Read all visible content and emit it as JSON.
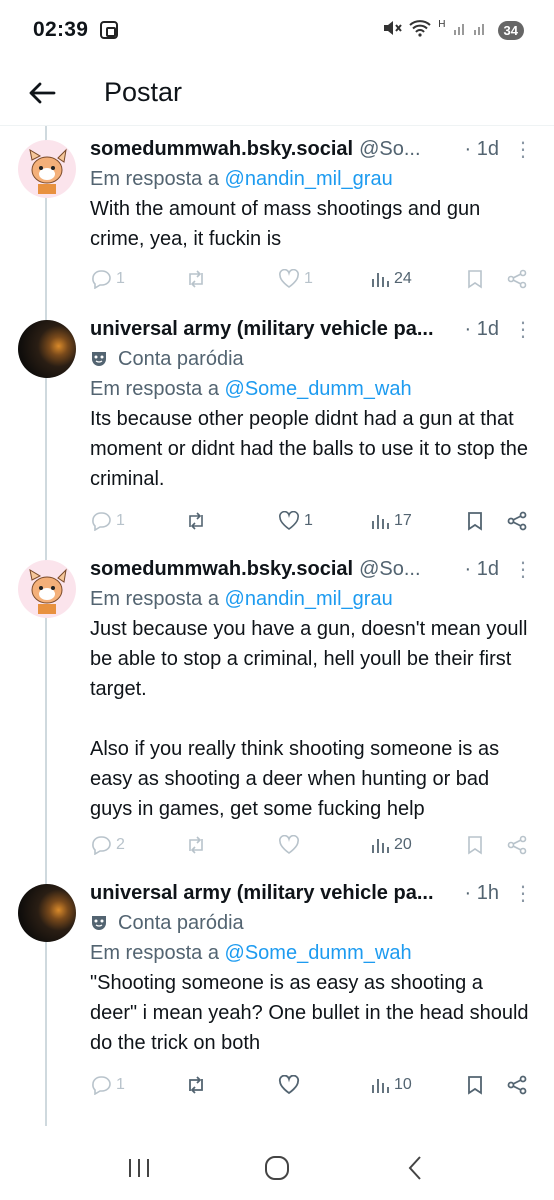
{
  "status_bar": {
    "time": "02:39",
    "battery": "34",
    "signal_label": "H"
  },
  "header": {
    "title": "Postar"
  },
  "replies": [
    {
      "display_name": "somedummwah.bsky.social",
      "handle": "@So...",
      "time": "· 1d",
      "parody": "",
      "reply_prefix": "Em resposta a ",
      "reply_to": "@nandin_mil_grau",
      "text": "With the amount of mass shootings and gun crime, yea, it fuckin is",
      "reply_count": "1",
      "repost_count": "",
      "like_count": "1",
      "view_count": "24"
    },
    {
      "display_name": "universal army (military vehicle pa...",
      "handle": "",
      "time": "· 1d",
      "parody": "Conta paródia",
      "reply_prefix": "Em resposta a ",
      "reply_to": "@Some_dumm_wah",
      "text": "Its because other people didnt had a gun at that moment or didnt had the balls to use it to stop the criminal.",
      "reply_count": "1",
      "repost_count": "",
      "like_count": "1",
      "view_count": "17"
    },
    {
      "display_name": "somedummwah.bsky.social",
      "handle": "@So...",
      "time": "· 1d",
      "parody": "",
      "reply_prefix": "Em resposta a ",
      "reply_to": "@nandin_mil_grau",
      "text": "Just because you have a gun, doesn't mean youll be able to stop a criminal, hell youll be their first target.\n\nAlso if you really think shooting someone is as easy as shooting a deer when hunting or bad guys in games, get some fucking help",
      "reply_count": "2",
      "repost_count": "",
      "like_count": "",
      "view_count": "20"
    },
    {
      "display_name": "universal army (military vehicle pa...",
      "handle": "",
      "time": "· 1h",
      "parody": "Conta paródia",
      "reply_prefix": "Em resposta a ",
      "reply_to": "@Some_dumm_wah",
      "text": "\"Shooting someone is as easy as shooting a deer\" i mean yeah? One bullet in the head should do the trick on both",
      "reply_count": "1",
      "repost_count": "",
      "like_count": "",
      "view_count": "10"
    }
  ],
  "icons": {
    "reply": "reply-icon",
    "repost": "repost-icon",
    "like": "heart-icon",
    "views": "views-icon",
    "bookmark": "bookmark-icon",
    "share": "share-icon",
    "parody": "parody-mask-icon"
  },
  "colors": {
    "accent": "#1d9bf0",
    "muted": "#536471",
    "text": "#0f1419"
  }
}
